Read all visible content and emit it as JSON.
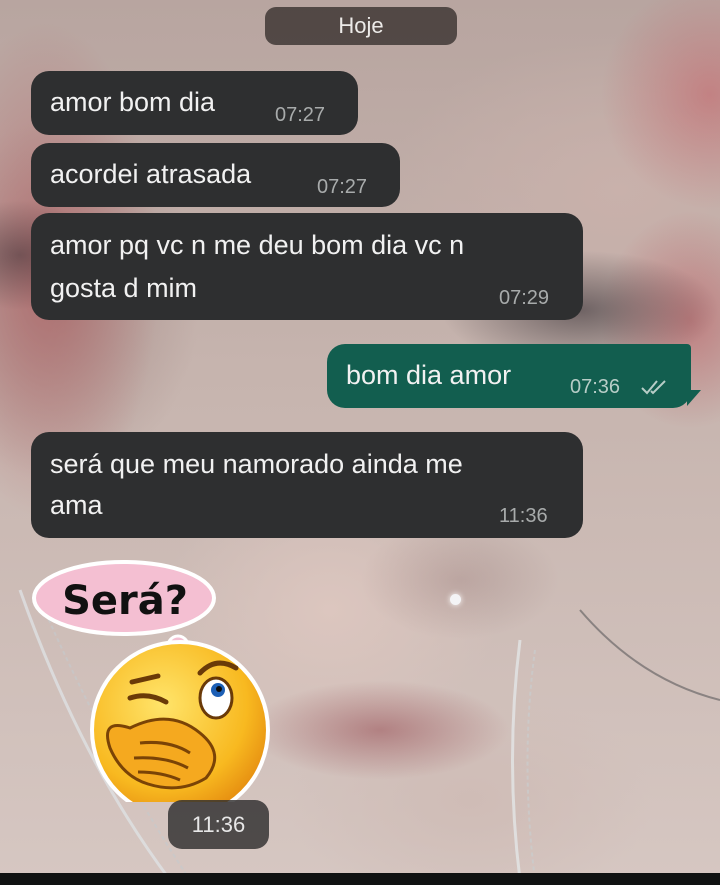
{
  "date_chip": "Hoje",
  "messages": [
    {
      "direction": "incoming",
      "lines": [
        "amor bom dia"
      ],
      "time": "07:27"
    },
    {
      "direction": "incoming",
      "lines": [
        "acordei atrasada"
      ],
      "time": "07:27"
    },
    {
      "direction": "incoming",
      "lines": [
        "amor pq vc n me deu bom dia vc n",
        "gosta d mim"
      ],
      "time": "07:29"
    },
    {
      "direction": "outgoing",
      "lines": [
        "bom dia amor"
      ],
      "time": "07:36",
      "status": "read"
    },
    {
      "direction": "incoming",
      "lines": [
        "será que meu namorado ainda me",
        "ama"
      ],
      "time": "11:36"
    }
  ],
  "sticker": {
    "text": "Será?",
    "icon": "thinking-winking-emoji-icon",
    "time": "11:36"
  },
  "colors": {
    "incoming_bubble": "#2e2f30",
    "outgoing_bubble": "#125e4f",
    "timestamp": "#a8abab",
    "read_ticks": "#b7cdc7",
    "sticker_cloud": "#f4bfd2"
  }
}
